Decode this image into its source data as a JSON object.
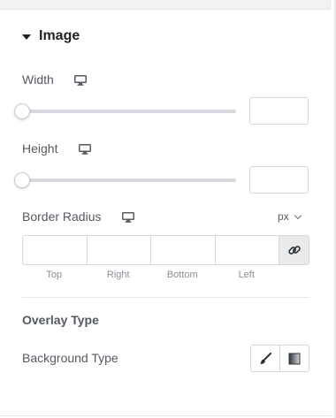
{
  "section": {
    "title": "Image"
  },
  "width": {
    "label": "Width",
    "device_icon": "desktop-icon",
    "value": "",
    "slider_value": 0
  },
  "height": {
    "label": "Height",
    "device_icon": "desktop-icon",
    "value": "",
    "slider_value": 0
  },
  "border_radius": {
    "label": "Border Radius",
    "device_icon": "desktop-icon",
    "unit": "px",
    "fields": [
      {
        "label": "Top",
        "value": ""
      },
      {
        "label": "Right",
        "value": ""
      },
      {
        "label": "Bottom",
        "value": ""
      },
      {
        "label": "Left",
        "value": ""
      }
    ],
    "link_icon": "link-icon"
  },
  "overlay_type": {
    "label": "Overlay Type"
  },
  "background_type": {
    "label": "Background Type",
    "options": [
      {
        "icon": "brush-icon",
        "name": "classic"
      },
      {
        "icon": "gradient-icon",
        "name": "gradient"
      }
    ]
  },
  "colors": {
    "text_primary": "#1f2124",
    "text_secondary": "#555a61",
    "border": "#d5d8dc",
    "muted_label": "#8a8f96"
  }
}
